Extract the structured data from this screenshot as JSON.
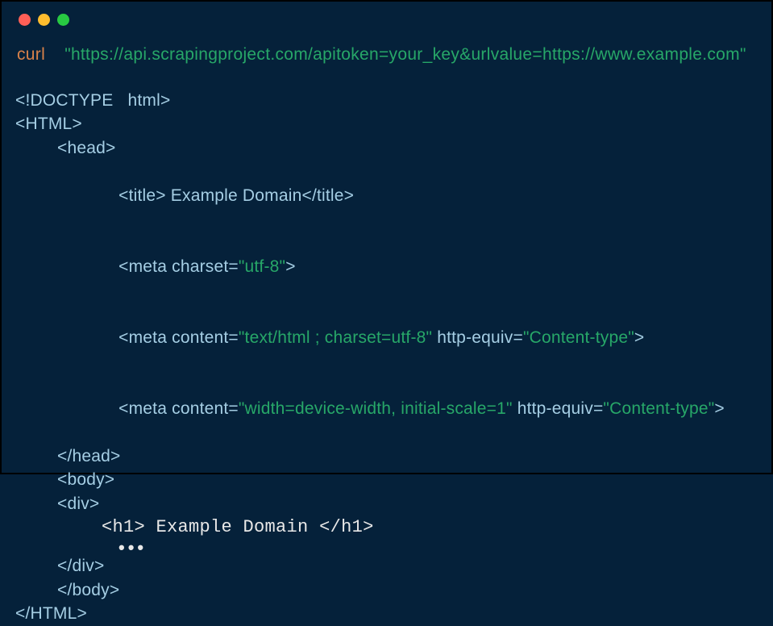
{
  "curl": {
    "command": "curl",
    "url": "\"https://api.scrapingproject.com/apitoken=your_key&urlvalue=https://www.example.com\""
  },
  "code": {
    "doctype": "<!DOCTYPE   html>",
    "html_open": "<HTML>",
    "head_open": "<head>",
    "title_open": "<title>",
    "title_text": " Example Domain",
    "title_close": "</title>",
    "meta1_open": "<meta charset=",
    "meta1_val": "\"utf-8\"",
    "meta1_close": ">",
    "meta2_open": "<meta content=",
    "meta2_val": "\"text/html ; charset=utf-8\"",
    "meta2_mid": " http-equiv=",
    "meta2_val2": "\"Content-type\"",
    "meta2_close": ">",
    "meta3_open": "<meta content=",
    "meta3_val": "\"width=device-width, initial-scale=1\"",
    "meta3_mid": " http-equiv=",
    "meta3_val2": "\"Content-type\"",
    "meta3_close": ">",
    "head_close": "</head>",
    "body_open": "<body>",
    "div_open": "<div>",
    "h1_open": "<h1>",
    "h1_text": " Example Domain ",
    "h1_close": "</h1>",
    "ellipsis": "•••",
    "div_close": "</div>",
    "body_close": "</body>",
    "html_close": "</HTML>"
  }
}
